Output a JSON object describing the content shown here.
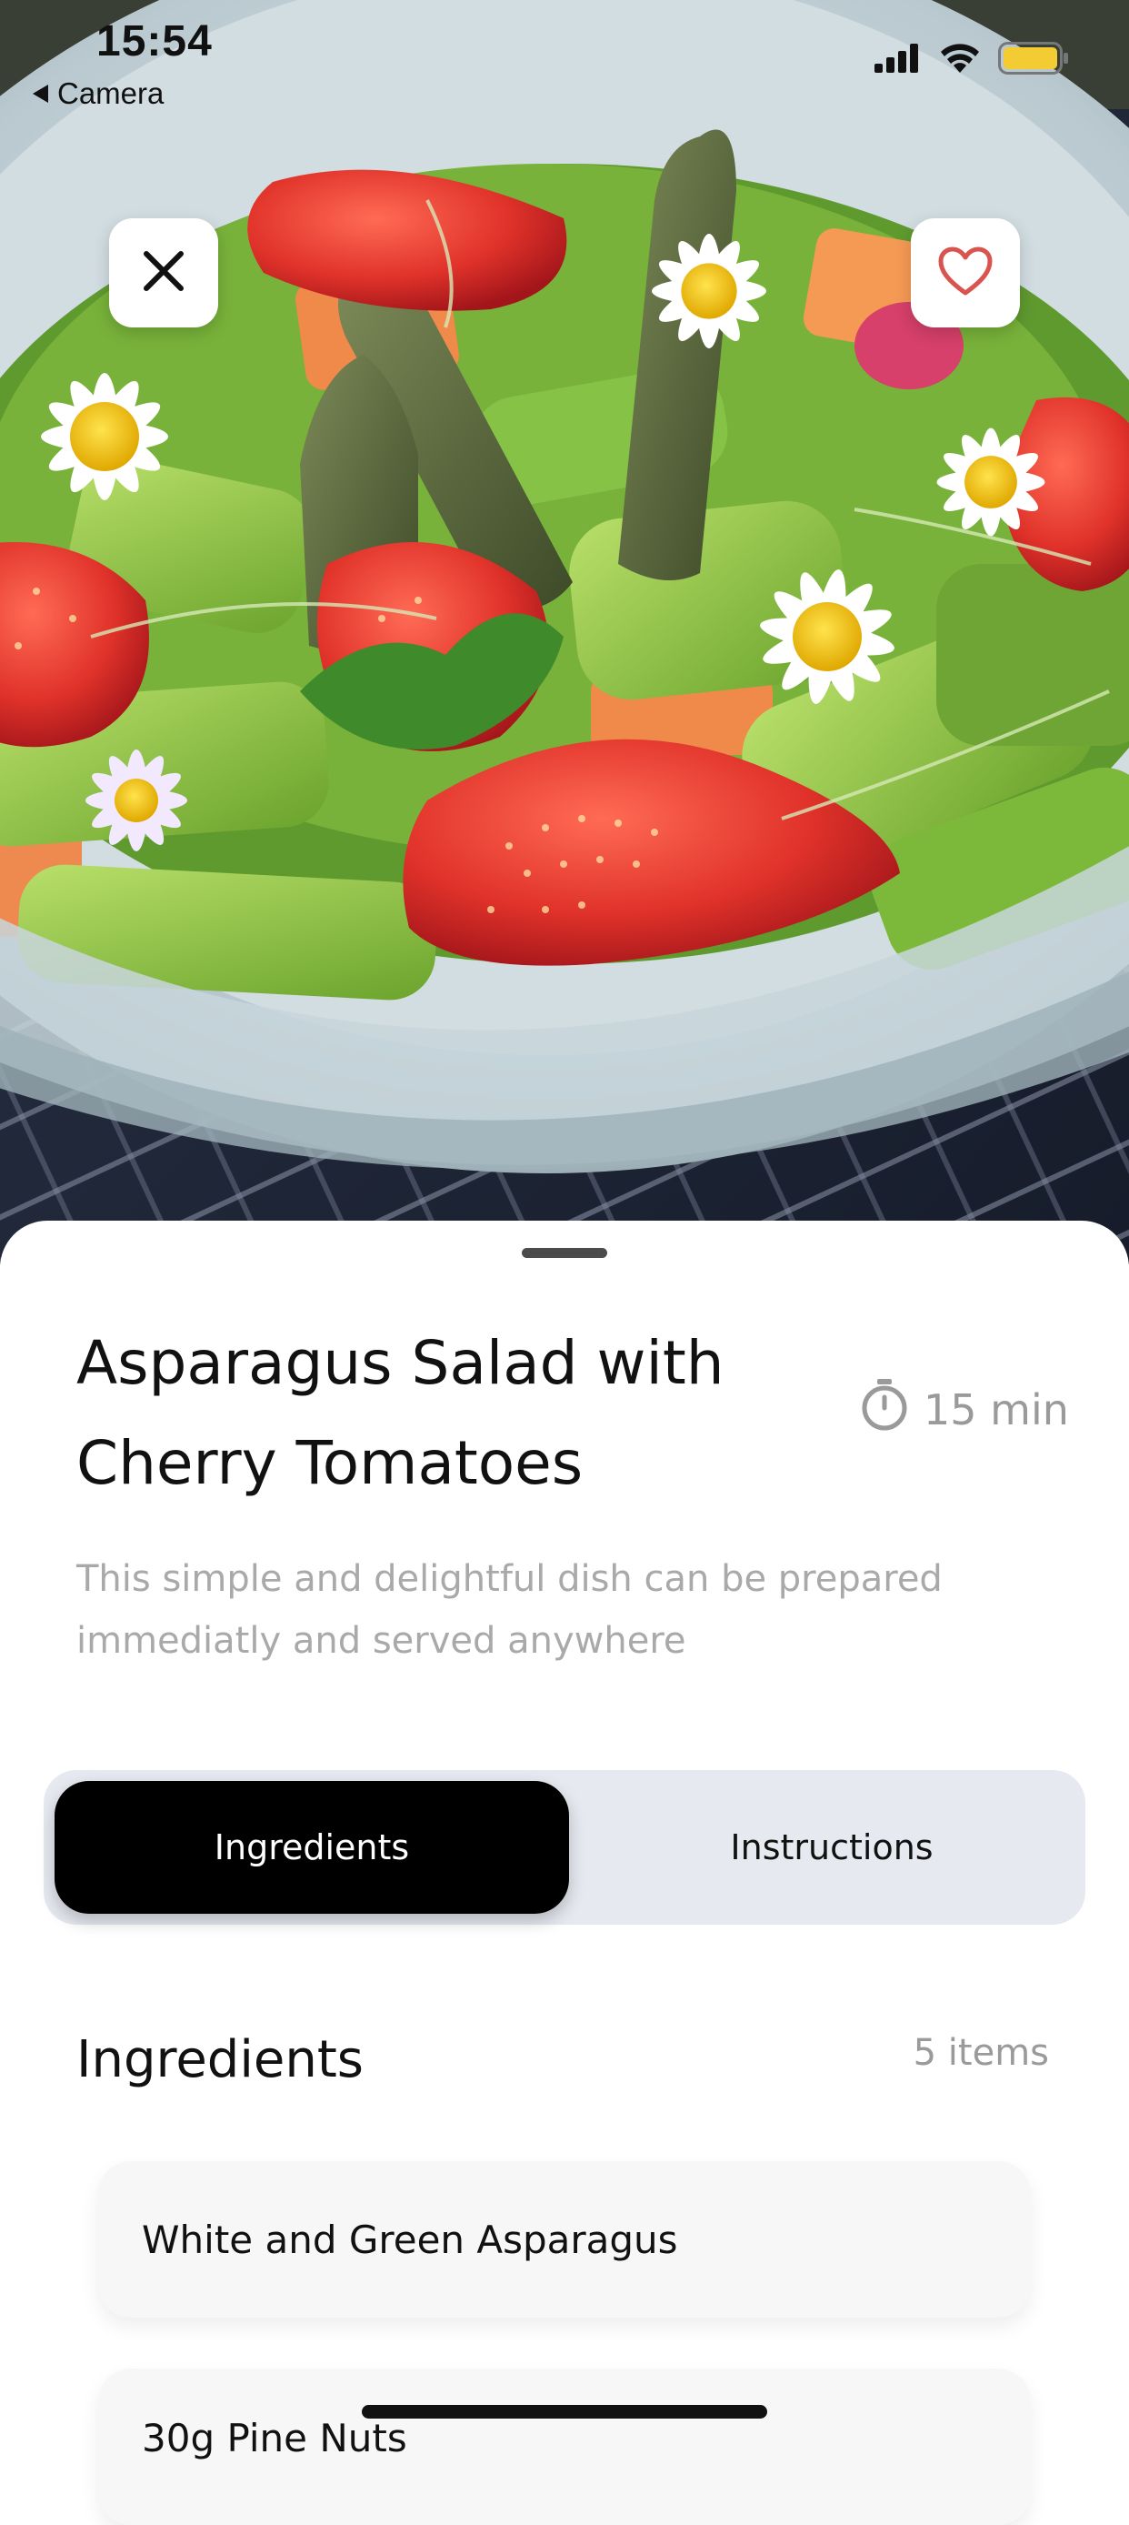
{
  "status_bar": {
    "time": "15:54",
    "back_label": "Camera"
  },
  "recipe": {
    "title": "Asparagus Salad with Cherry Tomatoes",
    "time": "15 min",
    "description": "This simple and delightful dish can be prepared immediatly and served anywhere"
  },
  "tabs": [
    {
      "label": "Ingredients",
      "active": true
    },
    {
      "label": "Instructions",
      "active": false
    }
  ],
  "ingredients_section": {
    "heading": "Ingredients",
    "count": "5 items",
    "items": [
      {
        "name": "White and Green Asparagus"
      },
      {
        "name": "30g Pine Nuts"
      }
    ]
  },
  "icons": {
    "close": "close-icon",
    "favorite": "heart-icon",
    "timer": "stopwatch-icon"
  },
  "colors": {
    "accent": "#d9534f",
    "active_tab_bg": "#000000",
    "segmented_bg": "#e6e9f0",
    "muted_text": "#9a9a9a"
  }
}
